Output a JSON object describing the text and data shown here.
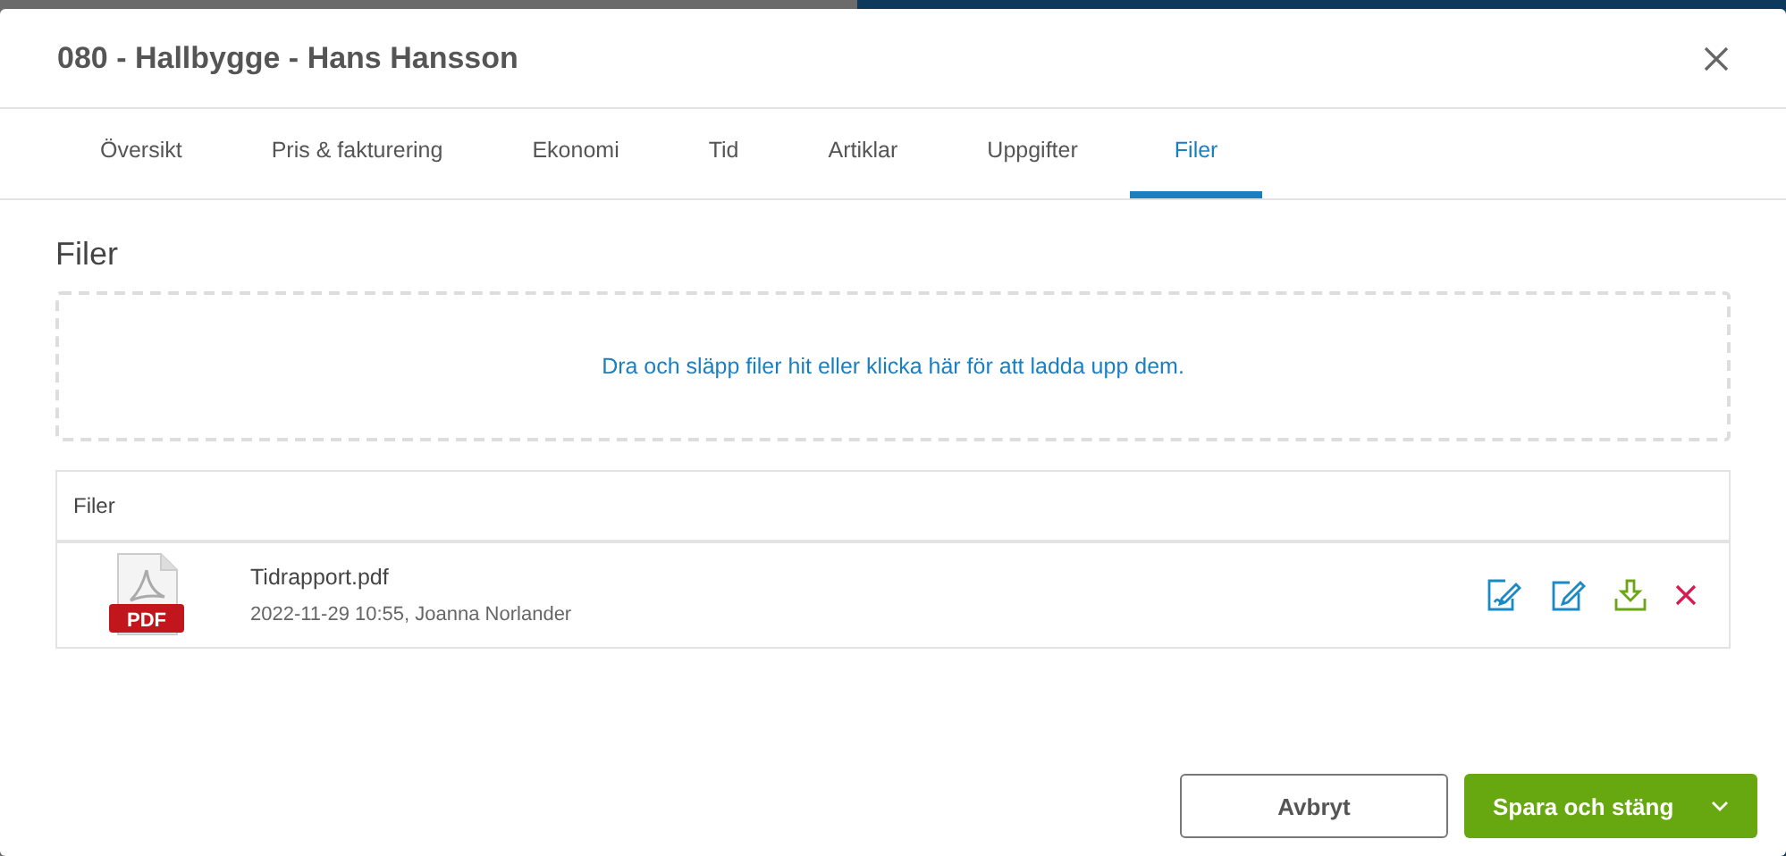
{
  "dialog": {
    "title": "080 - Hallbygge - Hans Hansson"
  },
  "tabs": [
    {
      "label": "Översikt",
      "selected": false
    },
    {
      "label": "Pris & fakturering",
      "selected": false
    },
    {
      "label": "Ekonomi",
      "selected": false
    },
    {
      "label": "Tid",
      "selected": false
    },
    {
      "label": "Artiklar",
      "selected": false
    },
    {
      "label": "Uppgifter",
      "selected": false
    },
    {
      "label": "Filer",
      "selected": true
    }
  ],
  "section_title": "Filer",
  "dropzone": {
    "text": "Dra och släpp filer hit eller klicka här för att ladda upp dem."
  },
  "files_table": {
    "header": "Filer",
    "rows": [
      {
        "type_label": "PDF",
        "name": "Tidrapport.pdf",
        "meta": "2022-11-29 10:55, Joanna Norlander",
        "actions": [
          {
            "kind": "sign"
          },
          {
            "kind": "edit"
          },
          {
            "kind": "download"
          },
          {
            "kind": "delete"
          }
        ]
      }
    ]
  },
  "buttons": [
    {
      "kind": "secondary",
      "label": "Avbryt"
    },
    {
      "kind": "primary",
      "label": "Spara och stäng",
      "dropdown": true
    }
  ]
}
